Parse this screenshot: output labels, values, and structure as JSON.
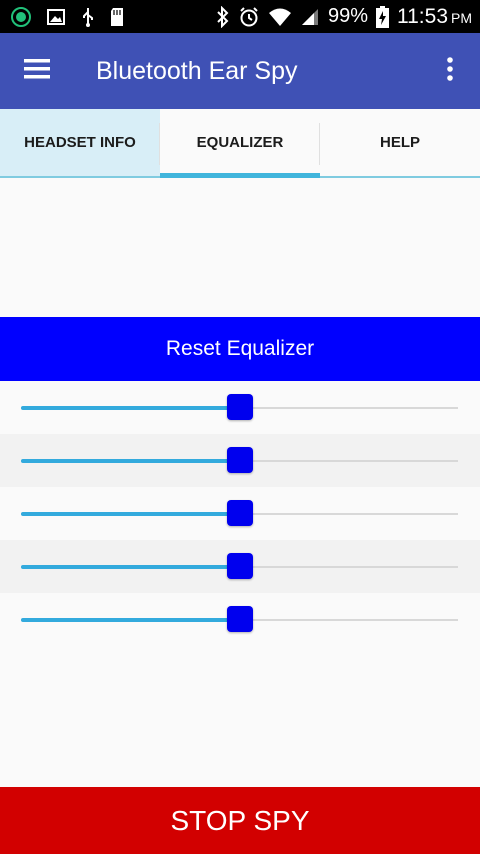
{
  "status_bar": {
    "battery": "99%",
    "time": "11:53",
    "ampm": "PM"
  },
  "app_bar": {
    "title": "Bluetooth Ear Spy",
    "color": "#3f51b5"
  },
  "tabs": [
    {
      "label": "HEADSET INFO"
    },
    {
      "label": "EQUALIZER"
    },
    {
      "label": "HELP"
    }
  ],
  "reset_label": "Reset Equalizer",
  "stop_label": "STOP SPY",
  "sliders": [
    {
      "value": 50
    },
    {
      "value": 50
    },
    {
      "value": 50
    },
    {
      "value": 50
    },
    {
      "value": 50
    }
  ],
  "colors": {
    "reset_bg": "#0000ff",
    "stop_bg": "#d20000",
    "slider_fill": "#33aadd",
    "thumb": "#0000ee",
    "tab_indicator": "#40b5dc"
  }
}
